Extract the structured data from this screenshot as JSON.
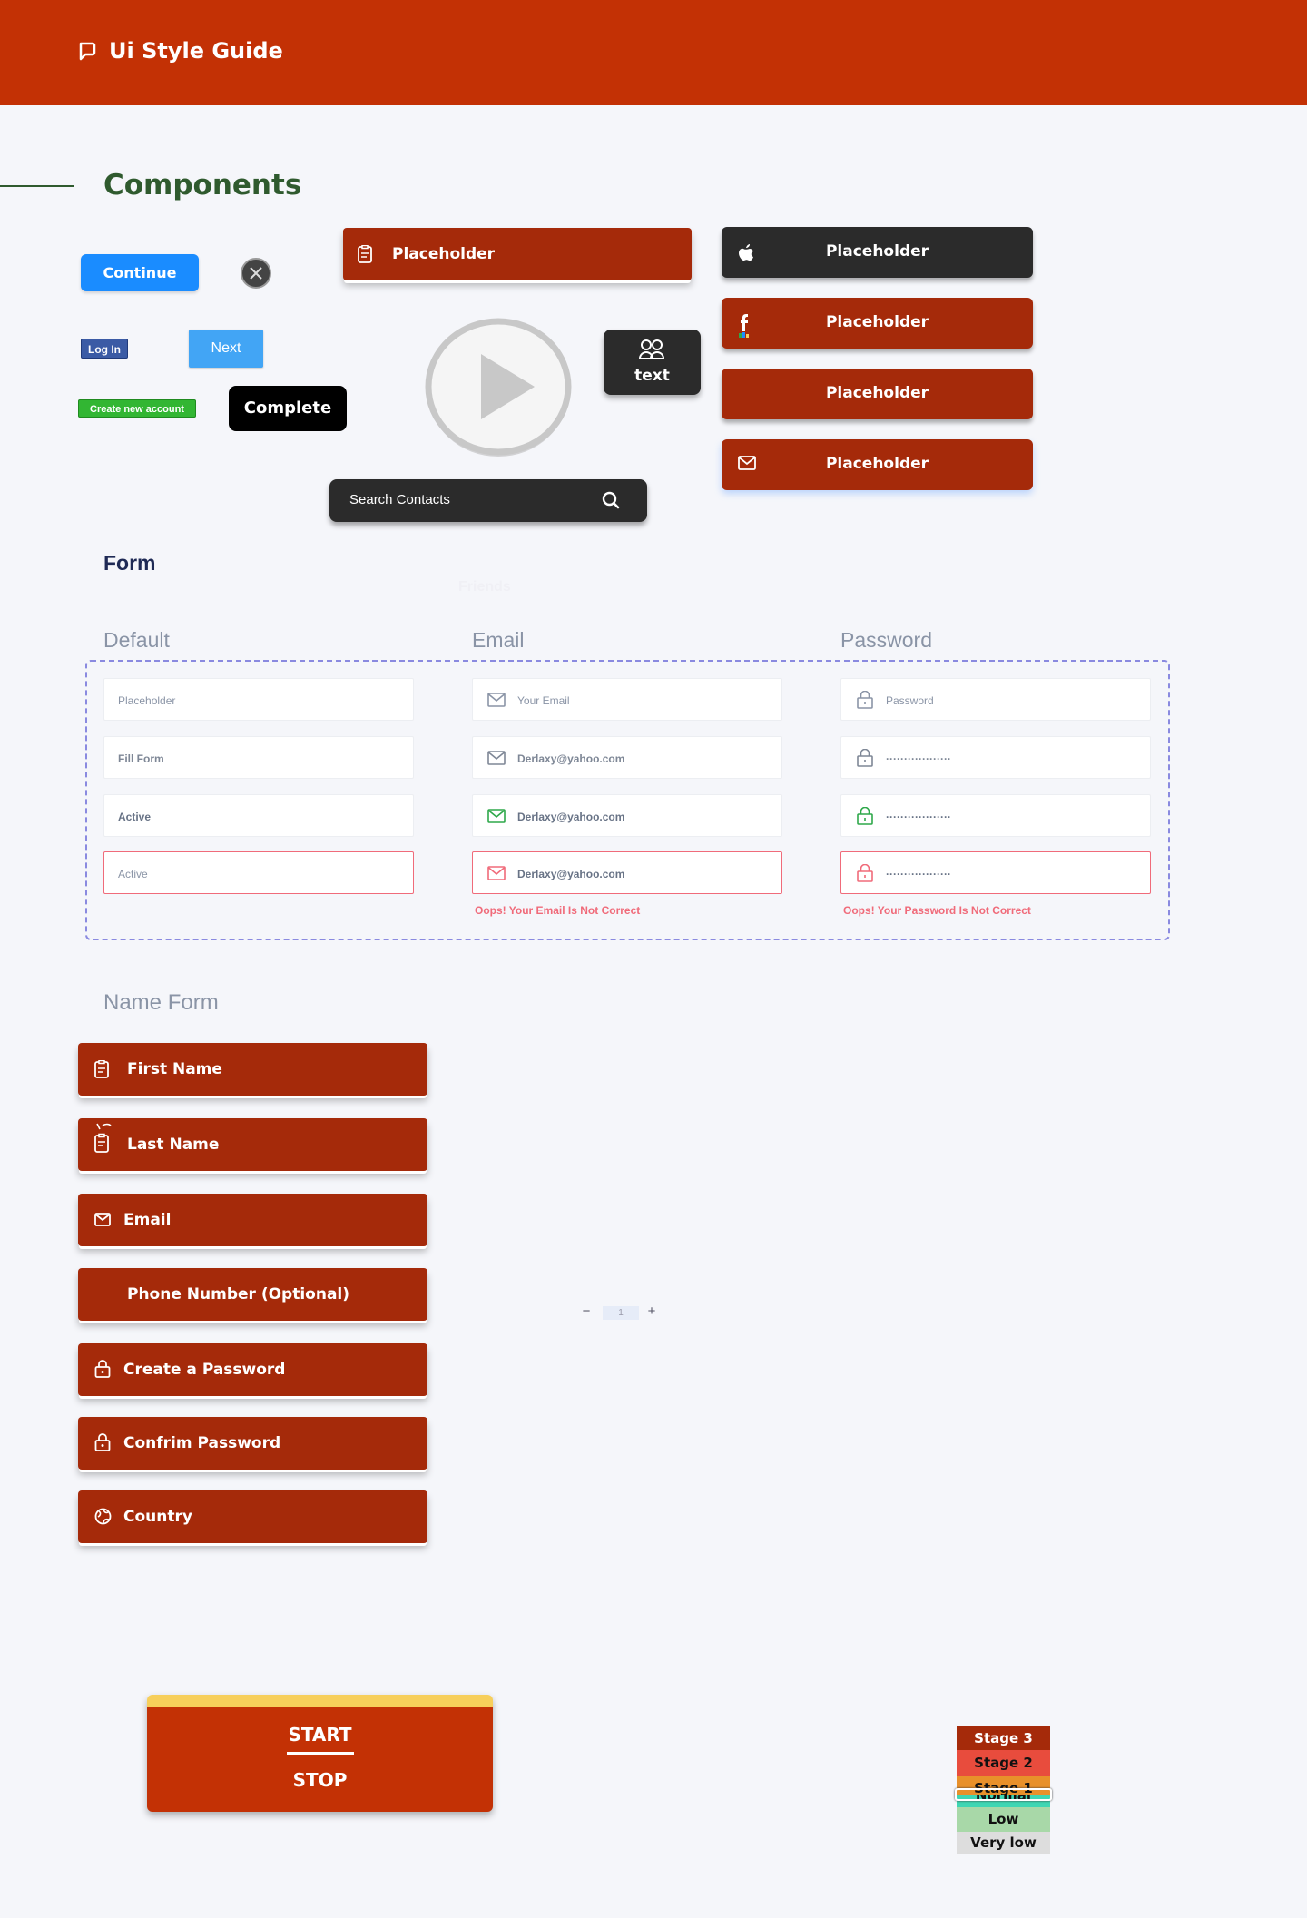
{
  "header": {
    "title": "Ui Style Guide"
  },
  "components": {
    "title": "Components",
    "continue_label": "Continue",
    "login_label": "Log In",
    "next_label": "Next",
    "create_account_label": "Create new account",
    "complete_label": "Complete",
    "placeholder_label": "Placeholder",
    "text_tile_label": "text",
    "search_placeholder": "Search Contacts",
    "friends_label": "Friends",
    "social_buttons": [
      {
        "label": "Placeholder",
        "icon": "apple-icon"
      },
      {
        "label": "Placeholder",
        "icon": "facebook-icon"
      },
      {
        "label": "Placeholder",
        "icon": ""
      },
      {
        "label": "Placeholder",
        "icon": "mail-icon"
      }
    ]
  },
  "form": {
    "title": "Form",
    "columns": {
      "default": "Default",
      "email": "Email",
      "password": "Password"
    },
    "default_fields": [
      "Placeholder",
      "Fill Form",
      "Active",
      "Active"
    ],
    "email_fields": [
      "Your Email",
      "Derlaxy@yahoo.com",
      "Derlaxy@yahoo.com",
      "Derlaxy@yahoo.com"
    ],
    "password_fields": [
      "Password",
      "··················",
      "··················",
      "··················"
    ],
    "email_error": "Oops! Your Email Is Not Correct",
    "password_error": "Oops! Your Password Is Not Correct",
    "colors": {
      "active_green": "#2ea84a",
      "error_red": "#f06b7a"
    }
  },
  "name_form": {
    "title": "Name Form",
    "fields": [
      {
        "label": "First Name",
        "icon": "clipboard-icon"
      },
      {
        "label": "Last Name",
        "icon": "clipboard-check-icon"
      },
      {
        "label": "Email",
        "icon": "mail-icon"
      },
      {
        "label": "Phone Number (Optional)",
        "icon": ""
      },
      {
        "label": "Create a Password",
        "icon": "lock-icon"
      },
      {
        "label": "Confrim Password",
        "icon": "lock-icon"
      },
      {
        "label": "Country",
        "icon": "globe-icon"
      }
    ]
  },
  "stepper": {
    "minus": "−",
    "value": "1",
    "plus": "+"
  },
  "start_stop": {
    "start": "START",
    "stop": "STOP"
  },
  "stages": [
    {
      "label": "Stage 3",
      "color": "#a52a0a",
      "text_color": "#ffffff"
    },
    {
      "label": "Stage 2",
      "color": "#e84c3d",
      "text_color": "#111111"
    },
    {
      "label": "Stage 1",
      "color": "#e8902a",
      "text_color": "#111111"
    },
    {
      "label": "Normal",
      "color": "#3fd6b3",
      "text_color": "#111111"
    },
    {
      "label": "Low",
      "color": "#a8d8a8",
      "text_color": "#111111"
    },
    {
      "label": "Very low",
      "color": "#dddddd",
      "text_color": "#111111"
    }
  ],
  "colors": {
    "brand": "#c33105",
    "button_red": "#a52a0a",
    "dark": "#2b2b2b",
    "heading_green": "#2f5a2e"
  }
}
